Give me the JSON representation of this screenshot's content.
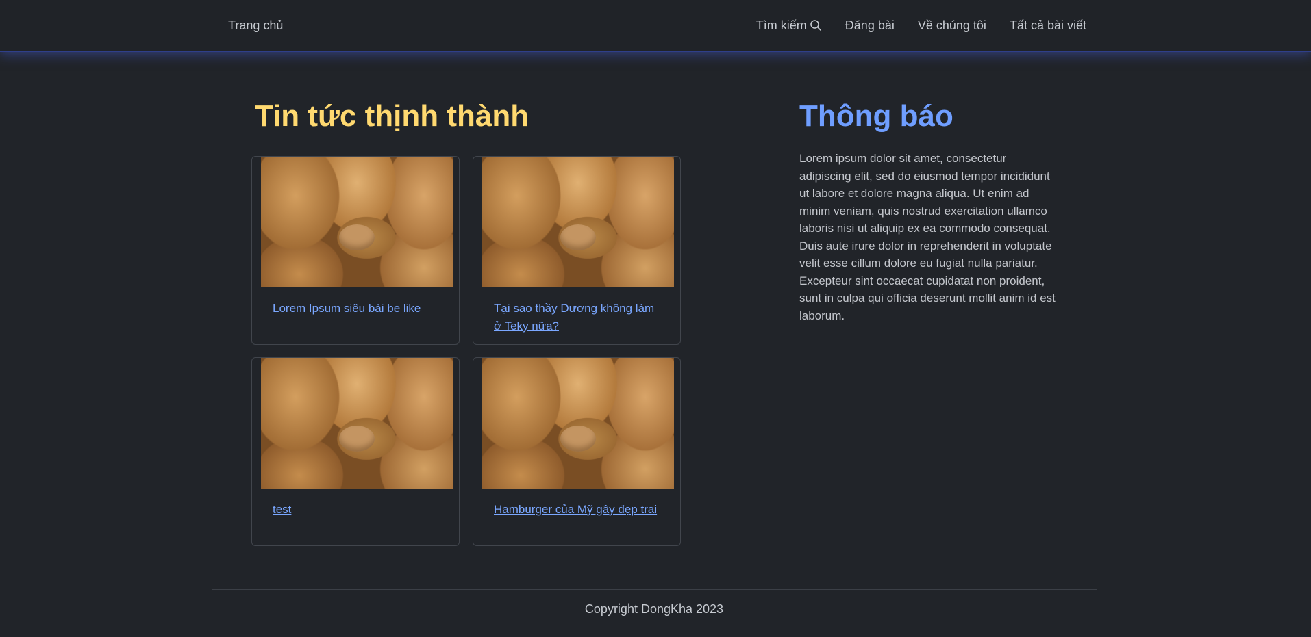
{
  "nav": {
    "home": "Trang chủ",
    "search": "Tìm kiếm",
    "post": "Đăng bài",
    "about": "Về chúng tôi",
    "all_posts": "Tất cả bài viết"
  },
  "main": {
    "title": "Tin tức thịnh thành",
    "cards": [
      {
        "title": "Lorem Ipsum siêu bài be like"
      },
      {
        "title": "Tại sao thầy Dương không làm ở Teky nữa?"
      },
      {
        "title": "test"
      },
      {
        "title": "Hamburger của Mỹ gây đẹp trai"
      }
    ]
  },
  "sidebar": {
    "title": "Thông báo",
    "text": "Lorem ipsum dolor sit amet, consectetur adipiscing elit, sed do eiusmod tempor incididunt ut labore et dolore magna aliqua. Ut enim ad minim veniam, quis nostrud exercitation ullamco laboris nisi ut aliquip ex ea commodo consequat. Duis aute irure dolor in reprehenderit in voluptate velit esse cillum dolore eu fugiat nulla pariatur. Excepteur sint occaecat cupidatat non proident, sunt in culpa qui officia deserunt mollit anim id est laborum."
  },
  "footer": {
    "text": "Copyright DongKha 2023"
  },
  "colors": {
    "background": "#212429",
    "accent_yellow": "#ffd970",
    "accent_blue": "#6f9eff",
    "link": "#7aa7ff"
  }
}
